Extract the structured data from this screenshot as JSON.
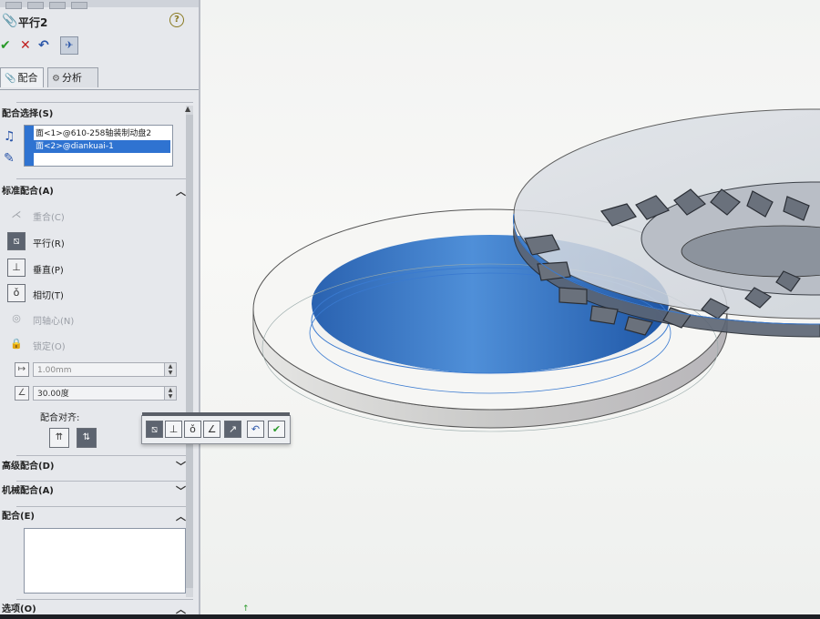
{
  "feature": {
    "title": "平行2"
  },
  "actions": {
    "ok": "✔",
    "cancel": "✕",
    "undo": "↶",
    "pin": "✈"
  },
  "tabs": [
    {
      "label": "配合"
    },
    {
      "label": "分析"
    }
  ],
  "sections": {
    "mate_selections": "配合选择(S)",
    "standard_mates": "标准配合(A)",
    "advanced_mates": "高级配合(D)",
    "mechanical_mates": "机械配合(A)",
    "mates": "配合(E)",
    "options": "选项(O)"
  },
  "selections": [
    "面<1>@610-258轴装制动盘2",
    "面<2>@diankuai-1"
  ],
  "standard_mates": [
    {
      "label": "重合(C)",
      "icon": "coincident-icon",
      "state": "dim"
    },
    {
      "label": "平行(R)",
      "icon": "parallel-icon",
      "state": "active"
    },
    {
      "label": "垂直(P)",
      "icon": "perpendicular-icon",
      "state": "normal"
    },
    {
      "label": "相切(T)",
      "icon": "tangent-icon",
      "state": "normal"
    },
    {
      "label": "同轴心(N)",
      "icon": "concentric-icon",
      "state": "dim"
    },
    {
      "label": "锁定(O)",
      "icon": "lock-icon",
      "state": "dim"
    }
  ],
  "distance": {
    "value": "1.00mm"
  },
  "angle": {
    "value": "30.00度"
  },
  "alignment": {
    "label": "配合对齐:"
  },
  "popup_toolbar": [
    "parallel",
    "perpendicular",
    "tangent",
    "angle",
    "flip",
    "undo",
    "ok"
  ]
}
